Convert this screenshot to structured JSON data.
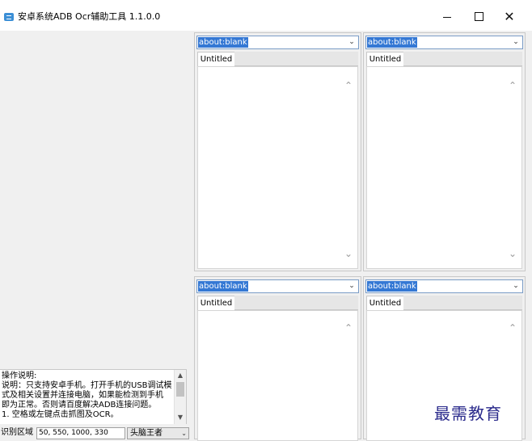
{
  "window": {
    "title": "安卓系统ADB Ocr辅助工具 1.1.0.0",
    "minimize_glyph": "",
    "maximize_glyph": "",
    "close_glyph": "✕"
  },
  "browser_panes": [
    {
      "url": "about:blank",
      "tab": "Untitled"
    },
    {
      "url": "about:blank",
      "tab": "Untitled"
    },
    {
      "url": "about:blank",
      "tab": "Untitled"
    },
    {
      "url": "about:blank",
      "tab": "Untitled"
    }
  ],
  "help": {
    "lines": [
      "操作说明:",
      "说明：只支持安卓手机。打开手机的USB调试模",
      "式及相关设置并连接电脑，如果能检测到手机",
      "即为正常。否则请百度解决ADB连接问题。",
      "1. 空格或左键点击抓图及OCR。"
    ]
  },
  "controls": {
    "region_label": "识别区域",
    "region_value": "50, 550, 1000, 330",
    "mode_value": "头脑王者"
  },
  "watermark": "最需教育",
  "icons": {
    "app": "app-window-icon",
    "dropdown": "chevron-down-icon",
    "scroll_up": "chevron-up-icon",
    "scroll_down": "chevron-down-icon"
  }
}
